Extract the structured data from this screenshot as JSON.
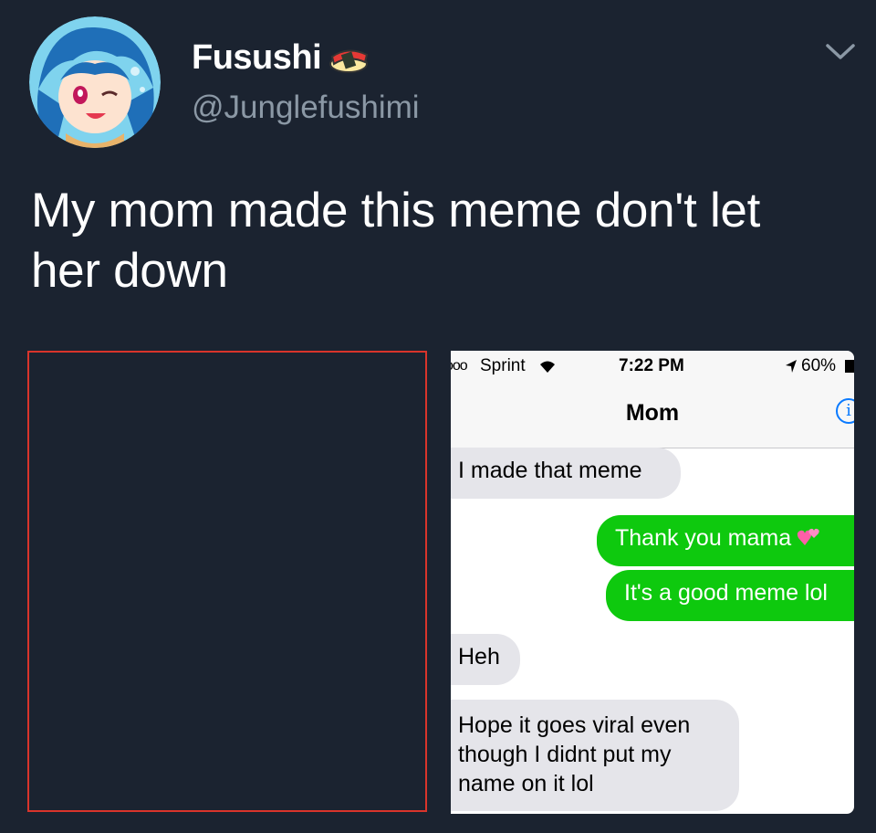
{
  "tweet": {
    "author_name": "Fusushi",
    "author_handle": "@Junglefushimi",
    "text": "My mom made this meme don't let her down",
    "avatar_icon": "anime-avatar",
    "name_emoji_icon": "sushi-emoji-icon",
    "menu_icon": "chevron-down-icon"
  },
  "phone": {
    "signal": "ooo",
    "carrier": "Sprint",
    "time": "7:22 PM",
    "battery": "60%",
    "contact": "Mom",
    "info_glyph": "i",
    "messages": [
      {
        "from": "them",
        "text": "I made that meme"
      },
      {
        "from": "me",
        "text": "Thank you mama"
      },
      {
        "from": "me",
        "text": "It's a good meme lol"
      },
      {
        "from": "them",
        "text": "Heh"
      },
      {
        "from": "them",
        "text": "Hope it goes viral even though I didnt put my name on it lol"
      }
    ]
  },
  "colors": {
    "background": "#1b2330",
    "handle": "#8b98a5",
    "outgoing_bubble": "#0ec90e",
    "incoming_bubble": "#e5e5ea",
    "media_border": "#d9342b"
  }
}
